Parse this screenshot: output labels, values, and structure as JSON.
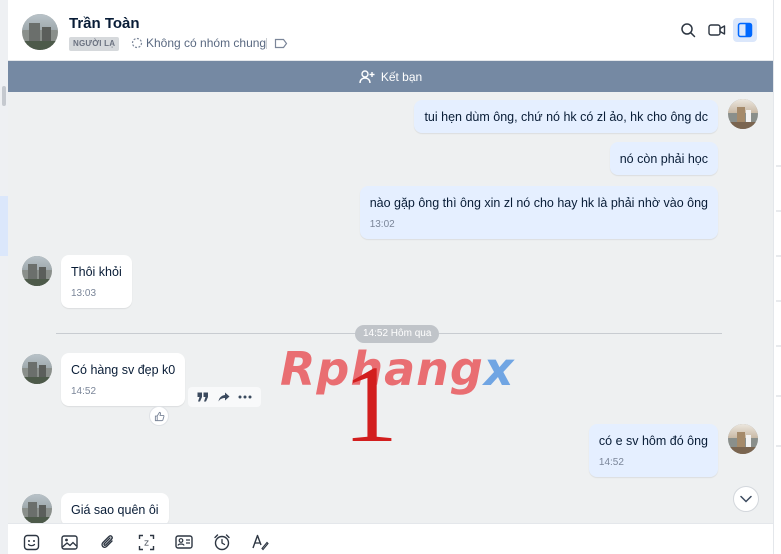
{
  "header": {
    "contact_name": "Trần Toàn",
    "badge": "NGƯỜI LẠ",
    "group_info": "Không có nhóm chung"
  },
  "add_friend": {
    "label": "Kết bạn"
  },
  "messages": [
    {
      "from": "me",
      "text": "tui hẹn dùm ông, chứ nó hk có zl ảo, hk cho ông dc"
    },
    {
      "from": "me",
      "text": "nó còn phải học"
    },
    {
      "from": "me",
      "text": "nào gặp ông thì ông xin zl nó cho hay hk là phải nhờ vào ông",
      "time": "13:02"
    },
    {
      "from": "them",
      "text": "Thôi khỏi",
      "time": "13:03"
    },
    {
      "from": "them",
      "text": "Có hàng sv đẹp k0",
      "time": "14:52"
    },
    {
      "from": "me",
      "text": "có  e sv hôm đó ông",
      "time": "14:52"
    },
    {
      "from": "them",
      "text": "Giá sao quên ôi"
    }
  ],
  "divider": {
    "label": "14:52 Hôm qua"
  },
  "watermark": {
    "text": "Rphang",
    "accent": "x",
    "overlay": "1"
  },
  "colors": {
    "accent": "#0068ff",
    "my_bubble": "#e5efff",
    "add_friend_bar": "#7589a3",
    "chat_bg": "#eef0f1"
  },
  "icons": [
    "search-icon",
    "video-call-icon",
    "sidebar-toggle-icon",
    "add-user-icon",
    "quote-icon",
    "share-icon",
    "more-icon",
    "like-icon",
    "chevron-down-icon",
    "sticker-icon",
    "image-icon",
    "attachment-icon",
    "screenshot-icon",
    "contact-card-icon",
    "reminder-icon",
    "format-text-icon"
  ]
}
